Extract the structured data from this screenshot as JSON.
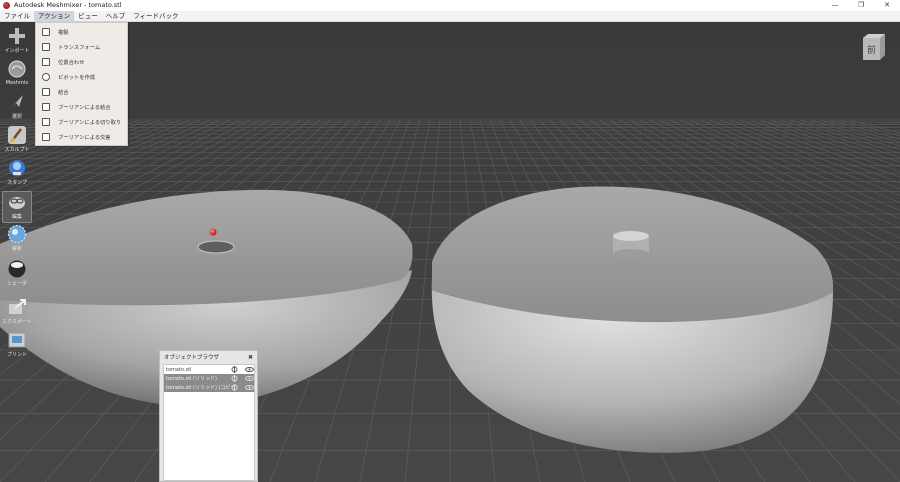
{
  "window": {
    "title": "Autodesk Meshmixer - tomato.stl",
    "minimize": "—",
    "restore": "❐",
    "close": "✕"
  },
  "menu": [
    {
      "label": "ファイル"
    },
    {
      "label": "アクション",
      "active": true
    },
    {
      "label": "ビュー"
    },
    {
      "label": "ヘルプ"
    },
    {
      "label": "フィードバック"
    }
  ],
  "toolbar": [
    {
      "label": "インポート",
      "icon": "plus-icon"
    },
    {
      "label": "Meshmix",
      "icon": "meshmix-icon"
    },
    {
      "label": "選択",
      "icon": "select-arrow-icon"
    },
    {
      "label": "スカルプト",
      "icon": "brush-icon"
    },
    {
      "label": "スタンプ",
      "icon": "stamp-icon"
    },
    {
      "label": "編集",
      "icon": "edit-icon",
      "selected": true
    },
    {
      "label": "解析",
      "icon": "analysis-icon"
    },
    {
      "label": "シェーダ",
      "icon": "shader-sphere-icon"
    },
    {
      "label": "エクスポート",
      "icon": "export-icon"
    },
    {
      "label": "プリント",
      "icon": "print-icon"
    }
  ],
  "action_menu": [
    {
      "label": "複製",
      "icon": "duplicate-icon"
    },
    {
      "label": "トランスフォーム",
      "icon": "transform-icon"
    },
    {
      "label": "位置合わせ",
      "icon": "align-icon"
    },
    {
      "label": "ピボットを作成",
      "icon": "pivot-icon"
    },
    {
      "label": "結合",
      "icon": "combine-icon"
    },
    {
      "label": "ブーリアンによる結合",
      "icon": "boolean-union-icon"
    },
    {
      "label": "ブーリアンによる切り取り",
      "icon": "boolean-difference-icon"
    },
    {
      "label": "ブーリアンによる交差",
      "icon": "boolean-intersection-icon"
    }
  ],
  "viewcube": {
    "face_label": "前"
  },
  "object_browser": {
    "title": "オブジェクトブラウザ",
    "close": "✖",
    "items": [
      {
        "name": "tomato.stl",
        "selected": false
      },
      {
        "name": "tomato.stl (ソリッド)",
        "selected": true
      },
      {
        "name": "tomato.stl (ソリッド) (コピー)",
        "selected": true
      }
    ]
  },
  "colors": {
    "viewport_bg": "#3d3d3d",
    "mesh": "#b9b9b9",
    "pivot_marker": "#e02020"
  }
}
